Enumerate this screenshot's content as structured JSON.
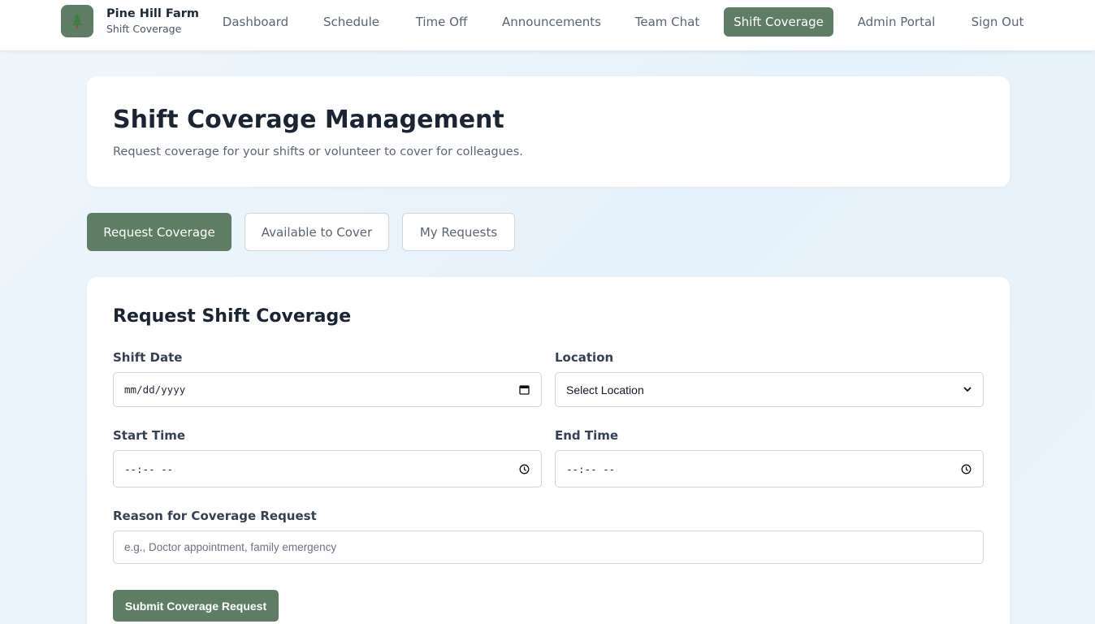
{
  "brand": {
    "logo_icon": "pine-tree-icon",
    "name": "Pine Hill Farm",
    "subtitle": "Shift Coverage"
  },
  "nav": {
    "items": [
      {
        "label": "Dashboard",
        "active": false
      },
      {
        "label": "Schedule",
        "active": false
      },
      {
        "label": "Time Off",
        "active": false
      },
      {
        "label": "Announcements",
        "active": false
      },
      {
        "label": "Team Chat",
        "active": false
      },
      {
        "label": "Shift Coverage",
        "active": true
      },
      {
        "label": "Admin Portal",
        "active": false
      },
      {
        "label": "Sign Out",
        "active": false
      }
    ]
  },
  "header": {
    "title": "Shift Coverage Management",
    "subtitle": "Request coverage for your shifts or volunteer to cover for colleagues."
  },
  "tabs": [
    {
      "label": "Request Coverage",
      "active": true
    },
    {
      "label": "Available to Cover",
      "active": false
    },
    {
      "label": "My Requests",
      "active": false
    }
  ],
  "form": {
    "title": "Request Shift Coverage",
    "shift_date": {
      "label": "Shift Date",
      "value": "mm/dd/yyyy",
      "icon": "calendar-icon"
    },
    "location": {
      "label": "Location",
      "selected": "Select Location",
      "icon": "chevron-down-icon"
    },
    "start_time": {
      "label": "Start Time",
      "value": "--:-- --",
      "icon": "clock-icon"
    },
    "end_time": {
      "label": "End Time",
      "value": "--:-- --",
      "icon": "clock-icon"
    },
    "reason": {
      "label": "Reason for Coverage Request",
      "placeholder": "e.g., Doctor appointment, family emergency"
    },
    "submit_label": "Submit Coverage Request"
  },
  "colors": {
    "accent": "#5f7d64",
    "background": "#eaf4fb",
    "text_dark": "#1b2433",
    "text_muted": "#5b6572"
  }
}
